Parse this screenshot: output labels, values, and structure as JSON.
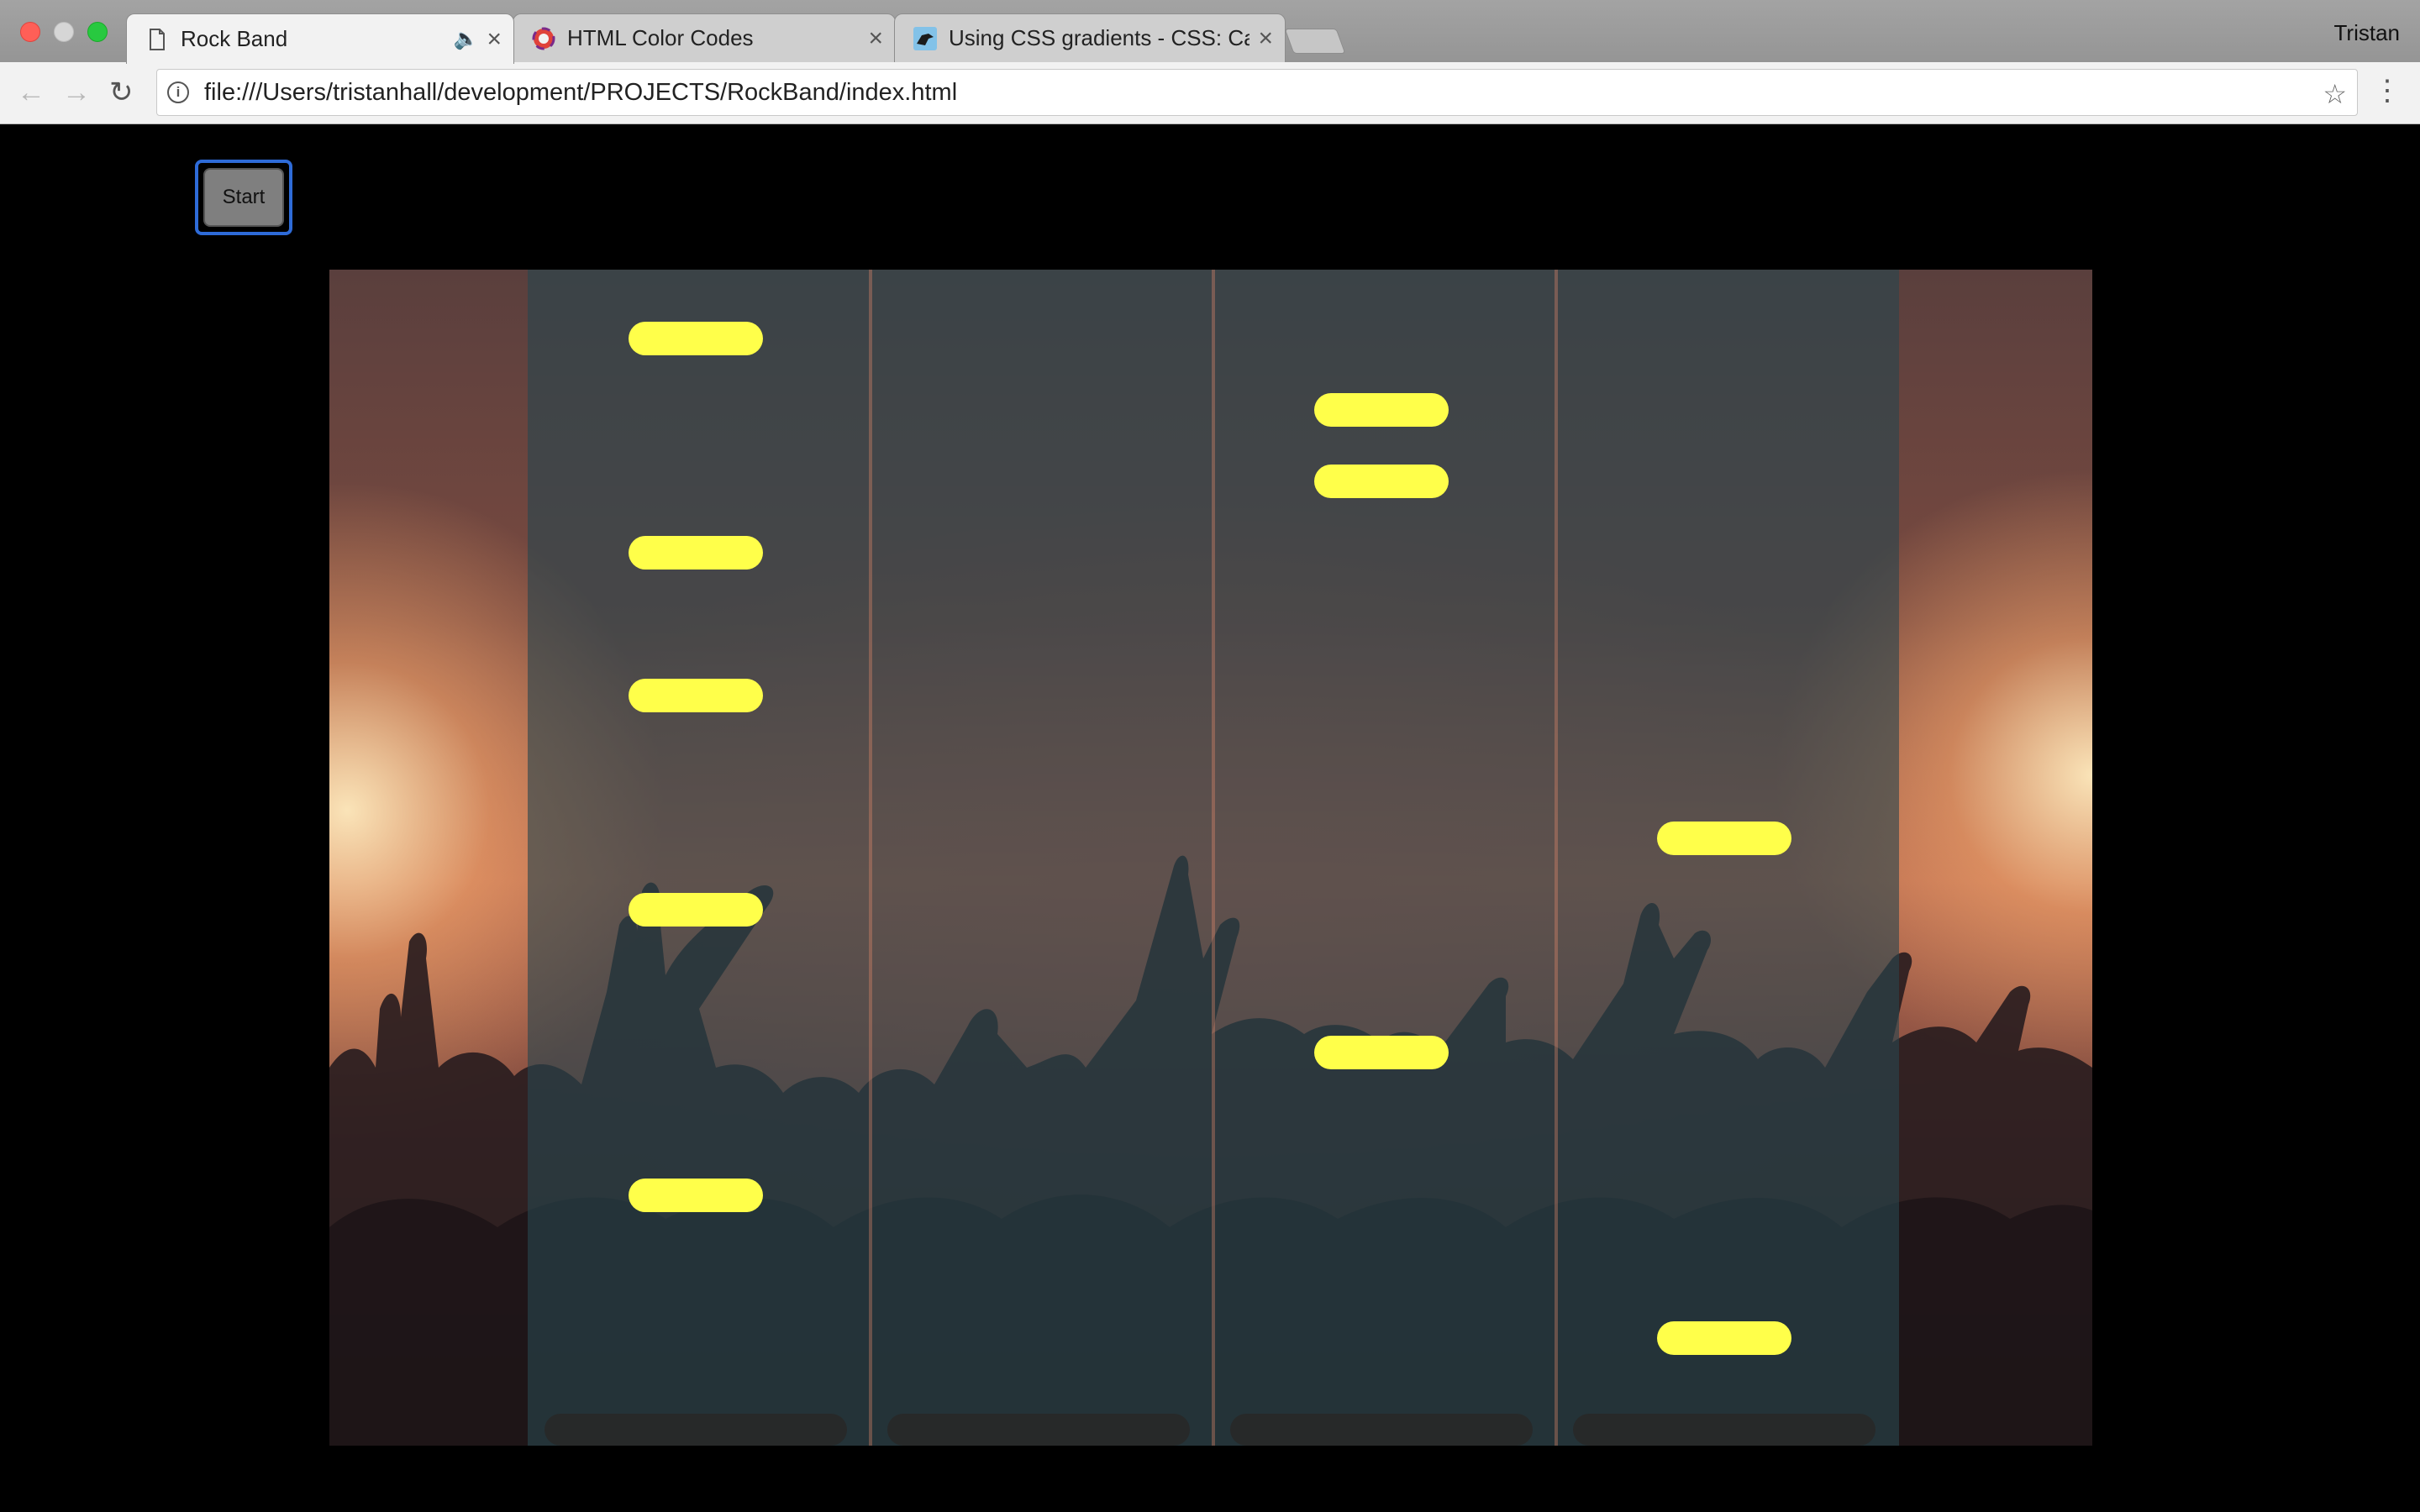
{
  "browser": {
    "tabs": [
      {
        "label": "Rock Band",
        "active": true,
        "audio": true,
        "favicon": "page-icon"
      },
      {
        "label": "HTML Color Codes",
        "active": false,
        "audio": false,
        "favicon": "colorwheel-icon"
      },
      {
        "label": "Using CSS gradients - CSS: Ca",
        "active": false,
        "audio": false,
        "favicon": "mdn-dino-icon"
      }
    ],
    "profile_name": "Tristan",
    "url": "file:///Users/tristanhall/development/PROJECTS/RockBand/index.html",
    "tab_close_glyph": "×",
    "audio_glyph": "🔈"
  },
  "page": {
    "start_button_label": "Start",
    "lanes": [
      {
        "id": 1,
        "notes": 5
      },
      {
        "id": 2,
        "notes": 0
      },
      {
        "id": 3,
        "notes": 3
      },
      {
        "id": 4,
        "notes": 2
      }
    ],
    "colors": {
      "note": "#ffff4a",
      "lane_overlay": "rgba(40,70,78,0.62)",
      "focus_ring": "#2e6bd8"
    }
  }
}
